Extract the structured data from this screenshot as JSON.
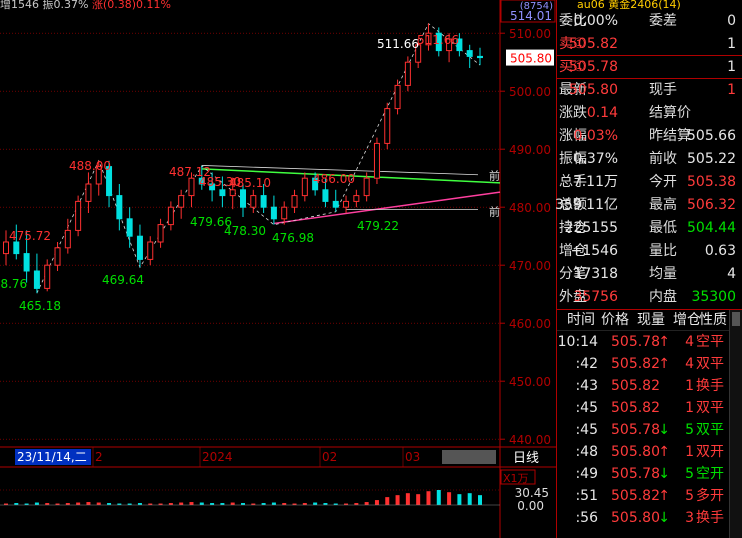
{
  "topbar": {
    "prefix": "增1546 振0.37%",
    "mid": "涨(0.38)0.11%"
  },
  "chart": {
    "price_axis": [
      "510.00",
      "500.00",
      "490.00",
      "480.00",
      "470.00",
      "460.00",
      "450.00",
      "440.00"
    ],
    "price_ticks": [
      510,
      500,
      490,
      480,
      470,
      460,
      450,
      440
    ],
    "price_box_top": "514.01",
    "price_box_top2": "(8754)",
    "current_price_label": "505.80",
    "high_labels": [
      {
        "text": "511.66",
        "color": "#ffffff"
      },
      {
        "text": "511.66",
        "color": "#ff3030"
      },
      {
        "text": "488.00",
        "color": "#ff3030"
      },
      {
        "text": "475.72",
        "color": "#ff3030"
      },
      {
        "text": "487.12",
        "color": "#ff3030"
      },
      {
        "text": "485.30",
        "color": "#ff3030"
      },
      {
        "text": "485.10",
        "color": "#ff3030"
      },
      {
        "text": "486.00",
        "color": "#ff3030"
      }
    ],
    "low_labels": [
      {
        "text": "68.76",
        "color": "#00e000"
      },
      {
        "text": "465.18",
        "color": "#00e000"
      },
      {
        "text": "469.64",
        "color": "#00e000"
      },
      {
        "text": "479.66",
        "color": "#00e000"
      },
      {
        "text": "478.30",
        "color": "#00e000"
      },
      {
        "text": "476.98",
        "color": "#00e000"
      },
      {
        "text": "479.22",
        "color": "#00e000"
      }
    ],
    "line_tags": [
      "前",
      "前"
    ],
    "date_axis": {
      "selected": "23/11/14,二",
      "labels": [
        "2",
        "2024",
        "02",
        "03"
      ],
      "period": "日线"
    },
    "volume": {
      "unit": "X1万",
      "top": "30.45",
      "bottom": "0.00"
    },
    "candles": [
      [
        472,
        476,
        470,
        474
      ],
      [
        474,
        477,
        471,
        472
      ],
      [
        472,
        476,
        467,
        469
      ],
      [
        469,
        472,
        465.18,
        466
      ],
      [
        466,
        471,
        465.5,
        470
      ],
      [
        470,
        474,
        469,
        473
      ],
      [
        473,
        478,
        472,
        476
      ],
      [
        476,
        482,
        475,
        481
      ],
      [
        481,
        486,
        479,
        484
      ],
      [
        484,
        488,
        482,
        487
      ],
      [
        487,
        488,
        480,
        482
      ],
      [
        482,
        484,
        476,
        478
      ],
      [
        478,
        480,
        473,
        475
      ],
      [
        475,
        477,
        469.64,
        471
      ],
      [
        471,
        475,
        470,
        474
      ],
      [
        474,
        478,
        473,
        477
      ],
      [
        477,
        481,
        476,
        480
      ],
      [
        480,
        483,
        478,
        482
      ],
      [
        482,
        486,
        480,
        485
      ],
      [
        485,
        487.12,
        483,
        484
      ],
      [
        484,
        486,
        481,
        483
      ],
      [
        483,
        485.3,
        480,
        482
      ],
      [
        482,
        485.1,
        479.66,
        483
      ],
      [
        483,
        484,
        478.3,
        480
      ],
      [
        480,
        483,
        479,
        482
      ],
      [
        482,
        484,
        479,
        480
      ],
      [
        480,
        482,
        476.98,
        478
      ],
      [
        478,
        481,
        477,
        480
      ],
      [
        480,
        483,
        479,
        482
      ],
      [
        482,
        486,
        481,
        485
      ],
      [
        485,
        486,
        482,
        483
      ],
      [
        483,
        485,
        480,
        481
      ],
      [
        481,
        483,
        479.22,
        480
      ],
      [
        480,
        482,
        479,
        481
      ],
      [
        481,
        483,
        480,
        482
      ],
      [
        482,
        486,
        481,
        485
      ],
      [
        485,
        492,
        484,
        491
      ],
      [
        491,
        498,
        490,
        497
      ],
      [
        497,
        502,
        496,
        501
      ],
      [
        501,
        506,
        500,
        505
      ],
      [
        505,
        509,
        504,
        508
      ],
      [
        508,
        511.66,
        507,
        510
      ],
      [
        510,
        511,
        506,
        507
      ],
      [
        507,
        510,
        505,
        509
      ],
      [
        509,
        510,
        506,
        507
      ],
      [
        507,
        508,
        504,
        506
      ],
      [
        506,
        507.5,
        504.5,
        505.8
      ]
    ],
    "volumes": [
      3,
      4,
      3,
      5,
      4,
      3,
      4,
      5,
      6,
      5,
      4,
      3,
      3,
      4,
      3,
      3,
      4,
      5,
      6,
      5,
      4,
      4,
      5,
      4,
      3,
      4,
      5,
      4,
      3,
      4,
      5,
      4,
      3,
      3,
      4,
      6,
      10,
      16,
      20,
      24,
      22,
      28,
      30.45,
      26,
      22,
      24,
      20
    ]
  },
  "quote": {
    "header": "au06 黄金2406(14)",
    "rows": [
      {
        "l": "委比",
        "v": "0.00%",
        "vc": "w",
        "l2": "委差",
        "v2": "0",
        "v2c": "w"
      },
      {
        "l": "卖①",
        "v": "505.82",
        "vc": "r",
        "l2": "",
        "v2": "1",
        "v2c": "w",
        "sep": true
      },
      {
        "l": "买①",
        "v": "505.78",
        "vc": "r",
        "l2": "",
        "v2": "1",
        "v2c": "w",
        "sep": true
      },
      {
        "l": "最新",
        "v": "505.80",
        "vc": "r",
        "l2": "现手",
        "v2": "1",
        "v2c": "r"
      },
      {
        "l": "涨跌",
        "v": "0.14",
        "vc": "r",
        "l2": "结算价",
        "v2": "",
        "v2c": "w"
      },
      {
        "l": "涨幅",
        "v": "0.03%",
        "vc": "r",
        "l2": "昨结算",
        "v2": "505.66",
        "v2c": "w"
      },
      {
        "l": "振幅",
        "v": "0.37%",
        "vc": "w",
        "l2": "前收",
        "v2": "505.22",
        "v2c": "w"
      },
      {
        "l": "总手",
        "v": "7.11万",
        "vc": "w",
        "l2": "今开",
        "v2": "505.38",
        "v2c": "r"
      },
      {
        "l": "总额",
        "v": "359.11亿",
        "vc": "w",
        "l2": "最高",
        "v2": "506.32",
        "v2c": "r"
      },
      {
        "l": "持仓",
        "v": "225155",
        "vc": "w",
        "l2": "最低",
        "v2": "504.44",
        "v2c": "g"
      },
      {
        "l": "增仓",
        "v": "+1546",
        "vc": "w",
        "l2": "量比",
        "v2": "0.63",
        "v2c": "w"
      },
      {
        "l": "分笔",
        "v": "17318",
        "vc": "w",
        "l2": "均量",
        "v2": "4",
        "v2c": "w"
      },
      {
        "l": "外盘",
        "v": "35756",
        "vc": "r",
        "l2": "内盘",
        "v2": "35300",
        "v2c": "g"
      }
    ]
  },
  "ticks": {
    "headers": [
      "时间",
      "价格",
      "现量",
      "增仓",
      "性质"
    ],
    "rows": [
      {
        "t": "10:14",
        "p": "505.78",
        "pc": "r",
        "a": "↑",
        "ac": "r",
        "q": "4",
        "qc": "r",
        "d": "",
        "n": "空平",
        "nc": "r"
      },
      {
        "t": ":42",
        "p": "505.82",
        "pc": "r",
        "a": "↑",
        "ac": "r",
        "q": "4",
        "qc": "r",
        "d": "",
        "n": "双平",
        "nc": "r"
      },
      {
        "t": ":43",
        "p": "505.82",
        "pc": "r",
        "a": "",
        "ac": "r",
        "q": "1",
        "qc": "r",
        "d": "",
        "n": "换手",
        "nc": "r"
      },
      {
        "t": ":45",
        "p": "505.82",
        "pc": "r",
        "a": "",
        "ac": "r",
        "q": "1",
        "qc": "r",
        "d": "",
        "n": "双平",
        "nc": "r"
      },
      {
        "t": ":45",
        "p": "505.78",
        "pc": "r",
        "a": "↓",
        "ac": "g",
        "q": "5",
        "qc": "g",
        "d": "",
        "n": "双平",
        "nc": "g"
      },
      {
        "t": ":48",
        "p": "505.80",
        "pc": "r",
        "a": "↑",
        "ac": "r",
        "q": "1",
        "qc": "r",
        "d": "",
        "n": "双开",
        "nc": "r"
      },
      {
        "t": ":49",
        "p": "505.78",
        "pc": "r",
        "a": "↓",
        "ac": "g",
        "q": "5",
        "qc": "g",
        "d": "",
        "n": "空开",
        "nc": "g"
      },
      {
        "t": ":51",
        "p": "505.82",
        "pc": "r",
        "a": "↑",
        "ac": "r",
        "q": "5",
        "qc": "r",
        "d": "",
        "n": "多开",
        "nc": "r"
      },
      {
        "t": ":56",
        "p": "505.80",
        "pc": "r",
        "a": "↓",
        "ac": "g",
        "q": "3",
        "qc": "r",
        "d": "",
        "n": "换手",
        "nc": "r"
      }
    ]
  },
  "colors": {
    "up": "#ff3030",
    "down": "#00e0e0",
    "grid": "#b00000",
    "bg": "#000000",
    "yellow": "#ffcc00",
    "green": "#00e000"
  }
}
